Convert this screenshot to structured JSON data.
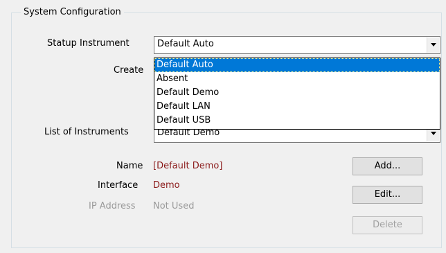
{
  "group": {
    "title": "System Configuration"
  },
  "startup": {
    "label": "Statup Instrument",
    "value": "Default Auto"
  },
  "create": {
    "label": "Create"
  },
  "dropdown": {
    "options": [
      "Default Auto",
      "Absent",
      "Default Demo",
      "Default LAN",
      "Default USB"
    ],
    "selected_index": 0
  },
  "instruments": {
    "label": "List of Instruments",
    "value": "Default Demo"
  },
  "details": {
    "name_label": "Name",
    "name_value": "[Default Demo]",
    "interface_label": "Interface",
    "interface_value": "Demo",
    "ip_label": "IP Address",
    "ip_value": "Not Used"
  },
  "buttons": {
    "add": "Add...",
    "edit": "Edit...",
    "delete": "Delete"
  },
  "colors": {
    "selection": "#0078d7",
    "value_red": "#8b1a1a",
    "disabled": "#9a9a9a"
  }
}
